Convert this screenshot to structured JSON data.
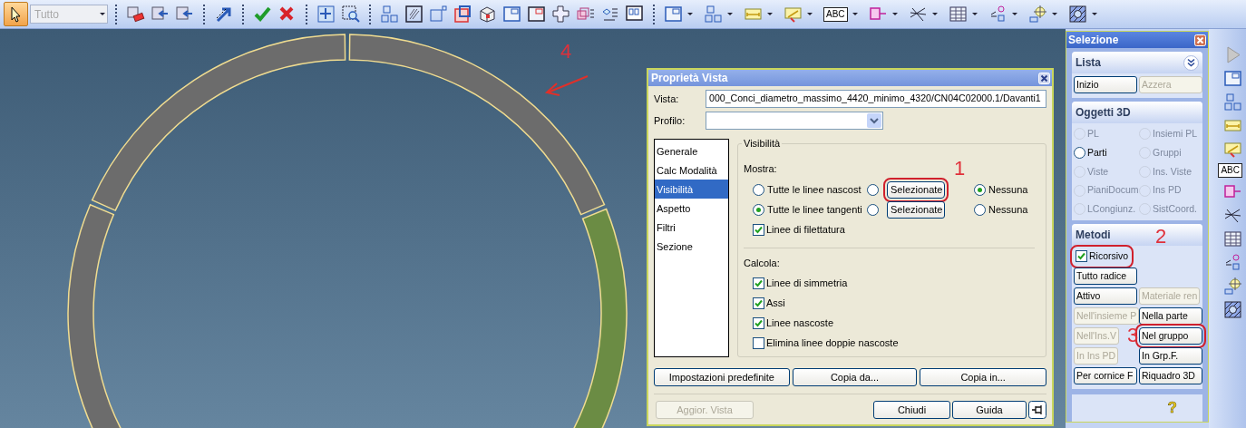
{
  "toolbar": {
    "select_tool": {
      "active": true
    },
    "filter_combo": {
      "value": "Tutto",
      "disabled": true
    },
    "text_tool_label": "ABC"
  },
  "canvas": {
    "segments": [
      {
        "selected": false
      },
      {
        "selected": false
      },
      {
        "selected": true
      },
      {
        "selected": false
      }
    ],
    "callout": "4"
  },
  "dialog": {
    "title": "Proprietà Vista",
    "vista": {
      "label": "Vista:",
      "value": "000_Conci_diametro_massimo_4420_minimo_4320/CN04C02000.1/Davanti1"
    },
    "profilo": {
      "label": "Profilo:"
    },
    "pages": [
      {
        "label": "Generale",
        "selected": false
      },
      {
        "label": "Calc Modalità",
        "selected": false
      },
      {
        "label": "Visibilità",
        "selected": true
      },
      {
        "label": "Aspetto",
        "selected": false
      },
      {
        "label": "Filtri",
        "selected": false
      },
      {
        "label": "Sezione",
        "selected": false
      }
    ],
    "group_title": "Visibilità",
    "mostra": {
      "label": "Mostra:",
      "rows": [
        {
          "label": "Tutte le linee nascost",
          "label_selected": false,
          "button": "Selezionate",
          "button_selected": false,
          "none_label": "Nessuna",
          "none_selected": true,
          "highlighted": true,
          "callout": "1"
        },
        {
          "label": "Tutte le linee tangenti",
          "label_selected": true,
          "button": "Selezionate",
          "button_selected": false,
          "none_label": "Nessuna",
          "none_selected": false,
          "highlighted": false
        }
      ],
      "thread_lines": {
        "label": "Linee di filettatura",
        "checked": true
      }
    },
    "calcola": {
      "label": "Calcola:",
      "items": [
        {
          "label": "Linee di simmetria",
          "checked": true
        },
        {
          "label": "Assi",
          "checked": true
        },
        {
          "label": "Linee nascoste",
          "checked": true
        },
        {
          "label": "Elimina linee doppie nascoste",
          "checked": false
        }
      ]
    },
    "buttons": [
      "Impostazioni predefinite",
      "Copia da...",
      "Copia in..."
    ],
    "update_button": {
      "label": "Aggior. Vista",
      "disabled": true
    },
    "close_button": "Chiudi",
    "help_button": "Guida"
  },
  "selection_panel": {
    "title": "Selezione",
    "lista": {
      "title": "Lista",
      "buttons": [
        {
          "label": "Inizio",
          "disabled": false
        },
        {
          "label": "Azzera",
          "disabled": true
        }
      ]
    },
    "oggetti": {
      "title": "Oggetti 3D",
      "options": [
        {
          "label": "PL",
          "disabled": true,
          "selected": false
        },
        {
          "label": "Insiemi PL",
          "disabled": true,
          "selected": false
        },
        {
          "label": "Parti",
          "disabled": false,
          "selected": false
        },
        {
          "label": "Gruppi",
          "disabled": true,
          "selected": false
        },
        {
          "label": "Viste",
          "disabled": true,
          "selected": false
        },
        {
          "label": "Ins. Viste",
          "disabled": true,
          "selected": false
        },
        {
          "label": "PianiDocum",
          "disabled": true,
          "selected": false
        },
        {
          "label": "Ins PD",
          "disabled": true,
          "selected": false
        },
        {
          "label": "LCongiunz.",
          "disabled": true,
          "selected": false
        },
        {
          "label": "SistCoord.",
          "disabled": true,
          "selected": false
        }
      ]
    },
    "metodi": {
      "title": "Metodi",
      "rows": [
        [
          {
            "kind": "checkbox",
            "label": "Ricorsivo",
            "checked": true,
            "highlighted": true,
            "callout": "2"
          }
        ],
        [
          {
            "kind": "button",
            "label": "Tutto radice",
            "disabled": false,
            "highlighted": false
          }
        ],
        [
          {
            "kind": "button",
            "label": "Attivo",
            "disabled": false,
            "highlighted": false
          },
          {
            "kind": "button",
            "label": "Materiale ren",
            "disabled": true,
            "highlighted": false
          }
        ],
        [
          {
            "kind": "button",
            "label": "Nell'insieme P",
            "disabled": true,
            "highlighted": false
          },
          {
            "kind": "button",
            "label": "Nella parte",
            "disabled": false,
            "highlighted": false
          }
        ],
        [
          {
            "kind": "button",
            "label": "Nell'Ins.V",
            "disabled": true,
            "highlighted": false
          },
          {
            "kind": "button",
            "label": "Nel gruppo",
            "disabled": false,
            "highlighted": true,
            "callout": "3"
          }
        ],
        [
          {
            "kind": "button",
            "label": "In Ins PD",
            "disabled": true,
            "highlighted": false
          },
          {
            "kind": "button",
            "label": "In Grp.F.",
            "disabled": false,
            "highlighted": false
          }
        ],
        [
          {
            "kind": "button",
            "label": "Per cornice F",
            "disabled": false,
            "highlighted": false
          },
          {
            "kind": "button",
            "label": "Riquadro 3D",
            "disabled": false,
            "highlighted": false
          }
        ]
      ]
    },
    "help_label": "?"
  },
  "side_toolbar": {
    "text_tool_label": "ABC"
  }
}
